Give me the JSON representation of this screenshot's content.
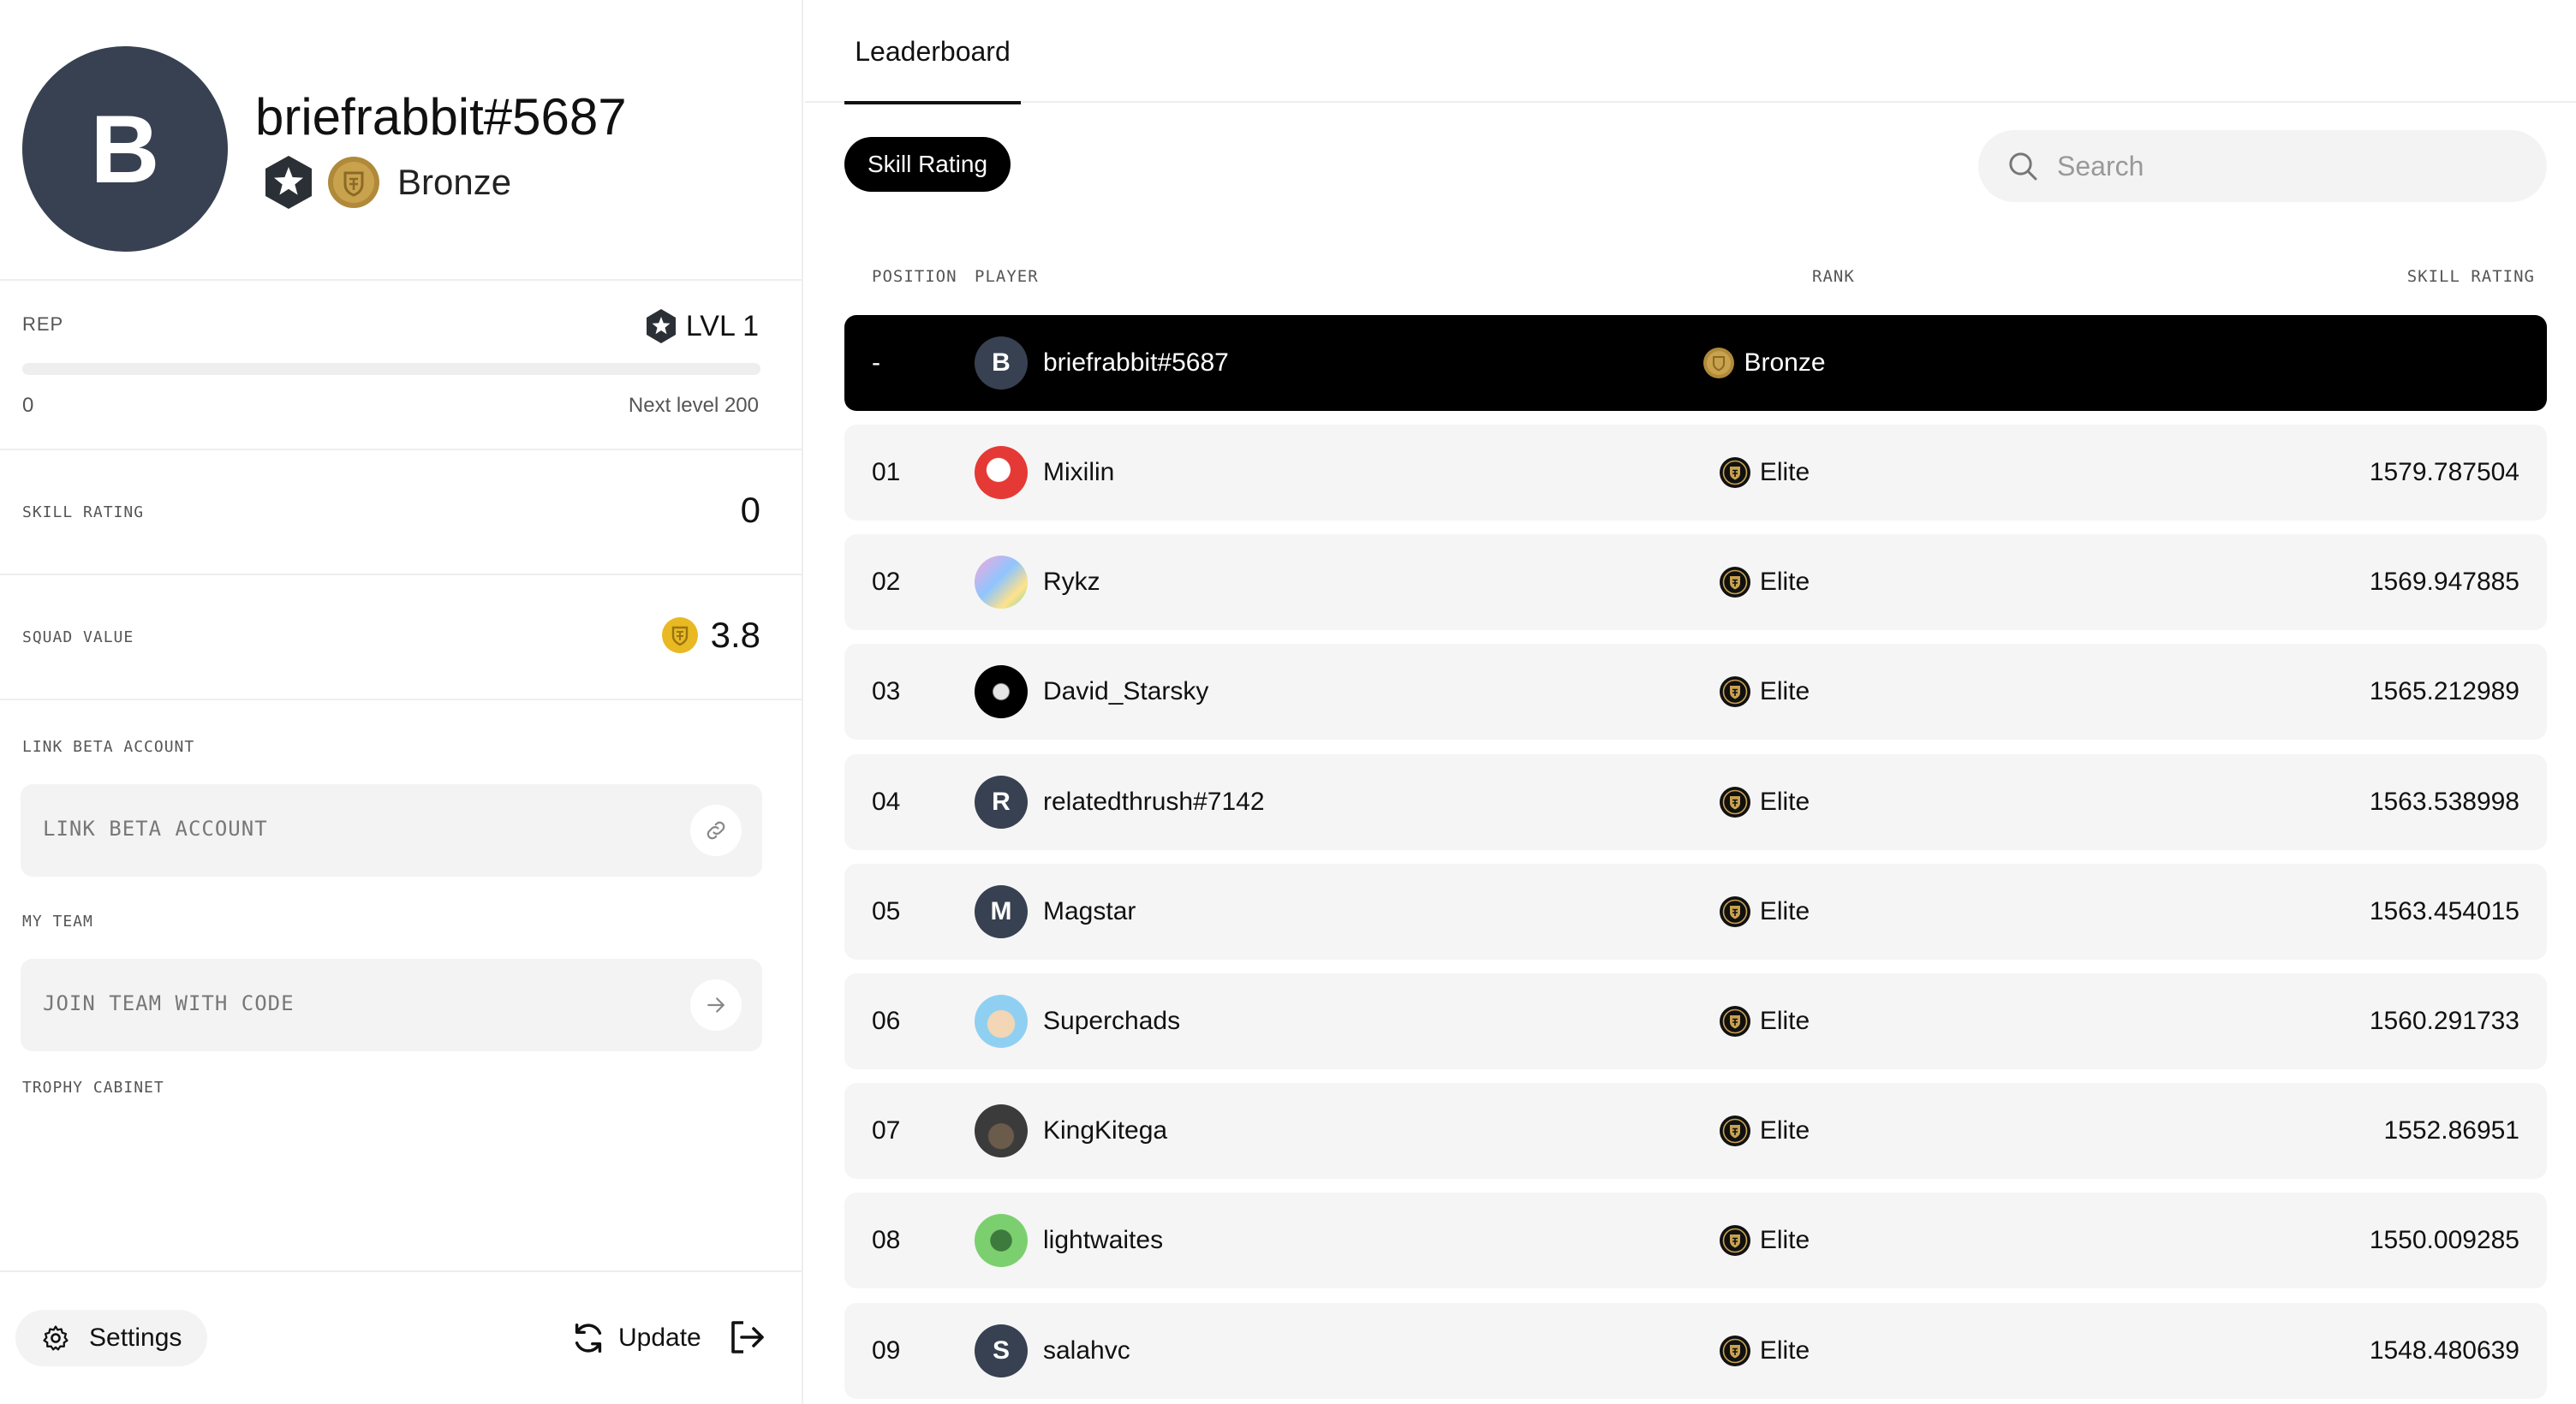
{
  "profile": {
    "avatar_initial": "B",
    "username": "briefrabbit#5687",
    "rank": "Bronze"
  },
  "rep": {
    "label": "REP",
    "level": "LVL 1",
    "progress": 0,
    "min": "0",
    "next_level": "Next level 200"
  },
  "skill_rating": {
    "label": "SKILL RATING",
    "value": "0"
  },
  "squad_value": {
    "label": "SQUAD VALUE",
    "value": "3.8"
  },
  "link_beta": {
    "label": "LINK BETA ACCOUNT",
    "placeholder": "LINK BETA ACCOUNT"
  },
  "my_team": {
    "label": "MY TEAM",
    "placeholder": "JOIN TEAM WITH CODE"
  },
  "trophy": {
    "label": "TROPHY CABINET"
  },
  "footer": {
    "settings": "Settings",
    "update": "Update"
  },
  "tabs": [
    {
      "label": "Leaderboard",
      "active": true
    }
  ],
  "filter_chip": "Skill Rating",
  "search": {
    "placeholder": "Search"
  },
  "columns": {
    "position": "POSITION",
    "player": "PLAYER",
    "rank": "RANK",
    "skill_rating": "SKILL RATING"
  },
  "current_user_row": {
    "position": "-",
    "initial": "B",
    "name": "briefrabbit#5687",
    "rank": "Bronze",
    "score": ""
  },
  "rows": [
    {
      "position": "01",
      "name": "Mixilin",
      "rank": "Elite",
      "score": "1579.787504",
      "avatar": "image-red",
      "initial": ""
    },
    {
      "position": "02",
      "name": "Rykz",
      "rank": "Elite",
      "score": "1569.947885",
      "avatar": "image-colorful",
      "initial": ""
    },
    {
      "position": "03",
      "name": "David_Starsky",
      "rank": "Elite",
      "score": "1565.212989",
      "avatar": "image-black",
      "initial": ""
    },
    {
      "position": "04",
      "name": "relatedthrush#7142",
      "rank": "Elite",
      "score": "1563.538998",
      "avatar": "initial",
      "initial": "R"
    },
    {
      "position": "05",
      "name": "Magstar",
      "rank": "Elite",
      "score": "1563.454015",
      "avatar": "initial",
      "initial": "M"
    },
    {
      "position": "06",
      "name": "Superchads",
      "rank": "Elite",
      "score": "1560.291733",
      "avatar": "image-lightblue",
      "initial": ""
    },
    {
      "position": "07",
      "name": "KingKitega",
      "rank": "Elite",
      "score": "1552.86951",
      "avatar": "image-dark",
      "initial": ""
    },
    {
      "position": "08",
      "name": "lightwaites",
      "rank": "Elite",
      "score": "1550.009285",
      "avatar": "image-green",
      "initial": ""
    },
    {
      "position": "09",
      "name": "salahvc",
      "rank": "Elite",
      "score": "1548.480639",
      "avatar": "initial",
      "initial": "S"
    }
  ],
  "colors": {
    "accent": "#000000",
    "avatar_initial_bg": "#374151",
    "bronze": "#b08a3a",
    "gold": "#e8b923",
    "row_bg": "#f5f5f5"
  },
  "icons": {
    "level": "hexagon-star-icon",
    "bronze": "bronze-coin-icon",
    "elite": "elite-badge-icon",
    "squad": "gold-coin-icon",
    "link": "link-icon",
    "arrow": "arrow-right-icon",
    "settings": "gear-icon",
    "update": "refresh-icon",
    "logout": "logout-icon",
    "search": "search-icon"
  }
}
